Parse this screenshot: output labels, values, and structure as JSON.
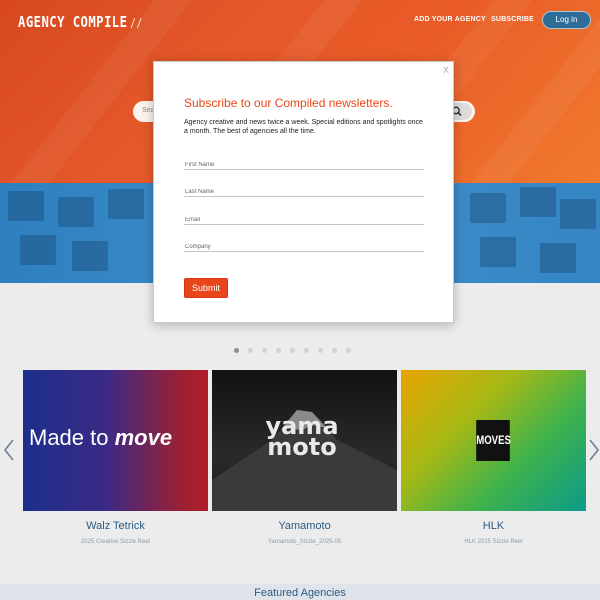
{
  "header": {
    "logo_text": "AGENCY COMPILE",
    "logo_mark": "//",
    "nav": [
      {
        "label": "ADD YOUR AGENCY"
      },
      {
        "label": "SUBSCRIBE"
      }
    ],
    "login_label": "Log in"
  },
  "search": {
    "placeholder": "Search"
  },
  "carousel": {
    "dot_count": 9,
    "active_index": 0,
    "cards": [
      {
        "title": "Walz Tetrick",
        "subtitle": "2025 Creative Sizzle Reel",
        "image_text_plain": "Made to ",
        "image_text_emph": "move"
      },
      {
        "title": "Yamamoto",
        "subtitle": "Yamamoto_Sizzle_2025-05",
        "image_text": "yama moto"
      },
      {
        "title": "HLK",
        "subtitle": "HLK 2025 Sizzle Reel",
        "image_text": "MOVES"
      }
    ]
  },
  "featured_heading": "Featured Agencies",
  "modal": {
    "close_label": "X",
    "title": "Subscribe to our Compiled newsletters.",
    "description": "Agency creative and news twice a week. Special editions and spotlights once a month. The best of agencies all the time.",
    "fields": [
      {
        "placeholder": "First Name",
        "value": ""
      },
      {
        "placeholder": "Last Name",
        "value": ""
      },
      {
        "placeholder": "Email",
        "value": ""
      },
      {
        "placeholder": "Company",
        "value": ""
      }
    ],
    "submit_label": "Submit"
  },
  "colors": {
    "hero_orange": "#e95c27",
    "band_blue": "#3f90cc",
    "accent_red": "#e8461a",
    "link_blue": "#2b5a84"
  }
}
